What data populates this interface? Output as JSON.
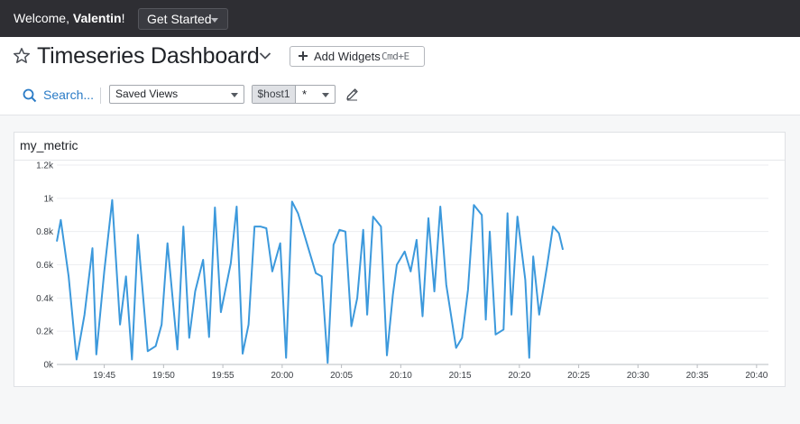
{
  "topbar": {
    "welcome_prefix": "Welcome, ",
    "welcome_name": "Valentin",
    "welcome_suffix": "!",
    "get_started_label": "Get Started"
  },
  "header": {
    "title": "Timeseries Dashboard",
    "add_widgets_label": "Add Widgets",
    "add_widgets_shortcut": "Cmd+E"
  },
  "toolbar": {
    "search_label": "Search...",
    "saved_views_value": "Saved Views",
    "template_variable": {
      "name": "$host1",
      "value": "*"
    }
  },
  "colors": {
    "series": "#3c99dc",
    "link": "#2a7bc6",
    "topbar": "#2e2e33"
  },
  "widget": {
    "title": "my_metric"
  },
  "chart_data": {
    "type": "line",
    "title": "my_metric",
    "y_ticks": [
      {
        "value": 0,
        "label": "0k"
      },
      {
        "value": 200,
        "label": "0.2k"
      },
      {
        "value": 400,
        "label": "0.4k"
      },
      {
        "value": 600,
        "label": "0.6k"
      },
      {
        "value": 800,
        "label": "0.8k"
      },
      {
        "value": 1000,
        "label": "1k"
      },
      {
        "value": 1200,
        "label": "1.2k"
      }
    ],
    "ylim": [
      0,
      1200
    ],
    "x_range": [
      "19:41",
      "20:41"
    ],
    "x_ticks": [
      "19:45",
      "19:50",
      "19:55",
      "20:00",
      "20:05",
      "20:10",
      "20:15",
      "20:20",
      "20:25",
      "20:30",
      "20:35",
      "20:40"
    ],
    "grid": true,
    "series": [
      {
        "color": "#3c99dc",
        "points": [
          [
            "19:41:00",
            740
          ],
          [
            "19:41:20",
            870
          ],
          [
            "19:42:00",
            530
          ],
          [
            "19:42:40",
            30
          ],
          [
            "19:43:20",
            300
          ],
          [
            "19:44:00",
            700
          ],
          [
            "19:44:20",
            60
          ],
          [
            "19:45:00",
            560
          ],
          [
            "19:45:40",
            990
          ],
          [
            "19:46:20",
            240
          ],
          [
            "19:46:50",
            530
          ],
          [
            "19:47:20",
            30
          ],
          [
            "19:47:50",
            780
          ],
          [
            "19:48:40",
            80
          ],
          [
            "19:49:20",
            110
          ],
          [
            "19:49:50",
            240
          ],
          [
            "19:50:20",
            730
          ],
          [
            "19:51:10",
            90
          ],
          [
            "19:51:40",
            830
          ],
          [
            "19:52:10",
            160
          ],
          [
            "19:52:40",
            440
          ],
          [
            "19:53:20",
            630
          ],
          [
            "19:53:50",
            165
          ],
          [
            "19:54:20",
            945
          ],
          [
            "19:54:50",
            315
          ],
          [
            "19:55:40",
            610
          ],
          [
            "19:56:10",
            950
          ],
          [
            "19:56:40",
            65
          ],
          [
            "19:57:10",
            240
          ],
          [
            "19:57:40",
            830
          ],
          [
            "19:58:10",
            830
          ],
          [
            "19:58:40",
            820
          ],
          [
            "19:59:10",
            560
          ],
          [
            "19:59:50",
            730
          ],
          [
            "20:00:20",
            40
          ],
          [
            "20:00:50",
            980
          ],
          [
            "20:01:20",
            910
          ],
          [
            "20:02:10",
            710
          ],
          [
            "20:02:50",
            550
          ],
          [
            "20:03:20",
            530
          ],
          [
            "20:03:50",
            10
          ],
          [
            "20:04:20",
            720
          ],
          [
            "20:04:50",
            810
          ],
          [
            "20:05:20",
            800
          ],
          [
            "20:05:50",
            230
          ],
          [
            "20:06:20",
            400
          ],
          [
            "20:06:50",
            810
          ],
          [
            "20:07:10",
            300
          ],
          [
            "20:07:40",
            890
          ],
          [
            "20:08:20",
            830
          ],
          [
            "20:08:50",
            55
          ],
          [
            "20:09:20",
            420
          ],
          [
            "20:09:40",
            600
          ],
          [
            "20:10:20",
            680
          ],
          [
            "20:10:50",
            560
          ],
          [
            "20:11:20",
            750
          ],
          [
            "20:11:50",
            290
          ],
          [
            "20:12:20",
            880
          ],
          [
            "20:12:50",
            440
          ],
          [
            "20:13:20",
            950
          ],
          [
            "20:13:50",
            480
          ],
          [
            "20:14:40",
            100
          ],
          [
            "20:15:10",
            160
          ],
          [
            "20:15:40",
            450
          ],
          [
            "20:16:10",
            960
          ],
          [
            "20:16:50",
            900
          ],
          [
            "20:17:10",
            270
          ],
          [
            "20:17:30",
            800
          ],
          [
            "20:18:00",
            180
          ],
          [
            "20:18:40",
            210
          ],
          [
            "20:19:00",
            910
          ],
          [
            "20:19:20",
            300
          ],
          [
            "20:19:50",
            890
          ],
          [
            "20:20:30",
            510
          ],
          [
            "20:20:50",
            40
          ],
          [
            "20:21:10",
            650
          ],
          [
            "20:21:40",
            300
          ],
          [
            "20:22:20",
            590
          ],
          [
            "20:22:50",
            830
          ],
          [
            "20:23:20",
            790
          ],
          [
            "20:23:40",
            690
          ]
        ]
      }
    ]
  }
}
